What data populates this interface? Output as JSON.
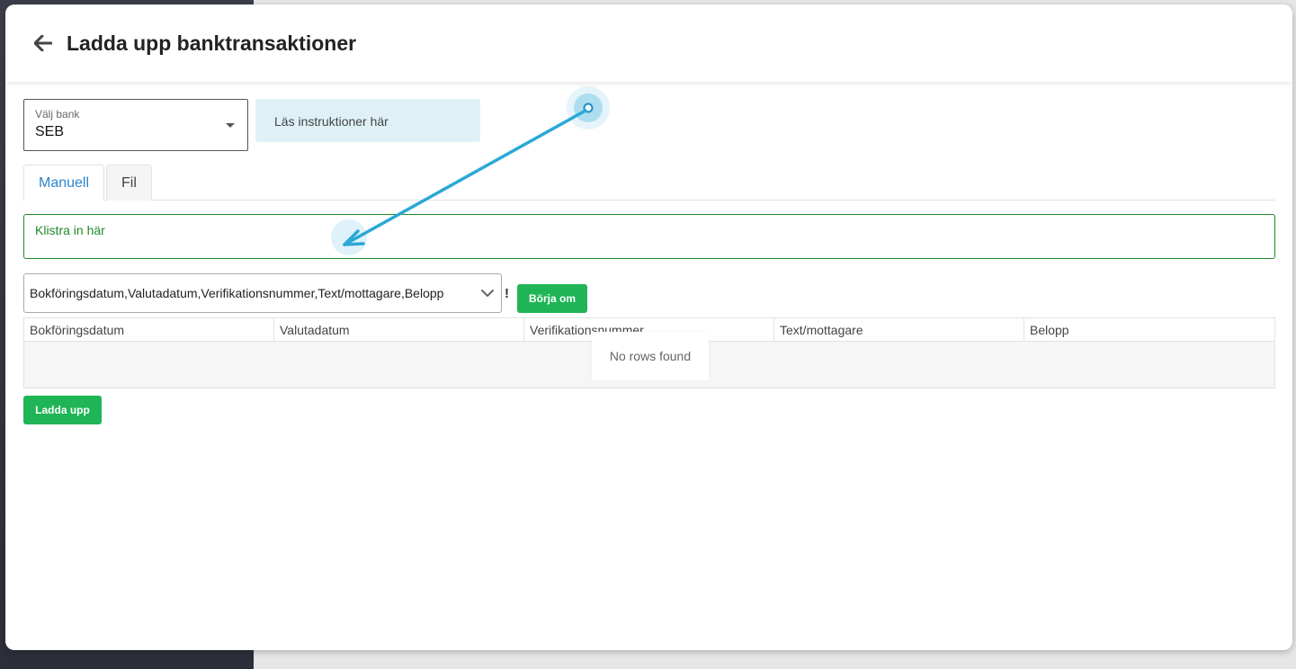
{
  "header": {
    "title": "Ladda upp banktransaktioner"
  },
  "bank_select": {
    "label": "Välj bank",
    "value": "SEB"
  },
  "instructions": {
    "label": "Läs instruktioner här"
  },
  "tabs": [
    {
      "label": "Manuell",
      "active": true
    },
    {
      "label": "Fil",
      "active": false
    }
  ],
  "paste_area": {
    "placeholder": "Klistra in här"
  },
  "column_format": {
    "value": "Bokföringsdatum,Valutadatum,Verifikationsnummer,Text/mottagare,Belopp"
  },
  "warning_mark": "!",
  "restart_button": "Börja om",
  "grid": {
    "columns": [
      "Bokföringsdatum",
      "Valutadatum",
      "Verifikationsnummer",
      "Text/mottagare",
      "Belopp"
    ],
    "empty_text": "No rows found"
  },
  "upload_button": "Ladda upp",
  "colors": {
    "accent_blue": "#2a85d0",
    "green": "#1fb556",
    "paste_border": "#1f8a2a",
    "instructions_bg": "#dff1f7",
    "annotation_arrow": "#2aa8d6"
  }
}
